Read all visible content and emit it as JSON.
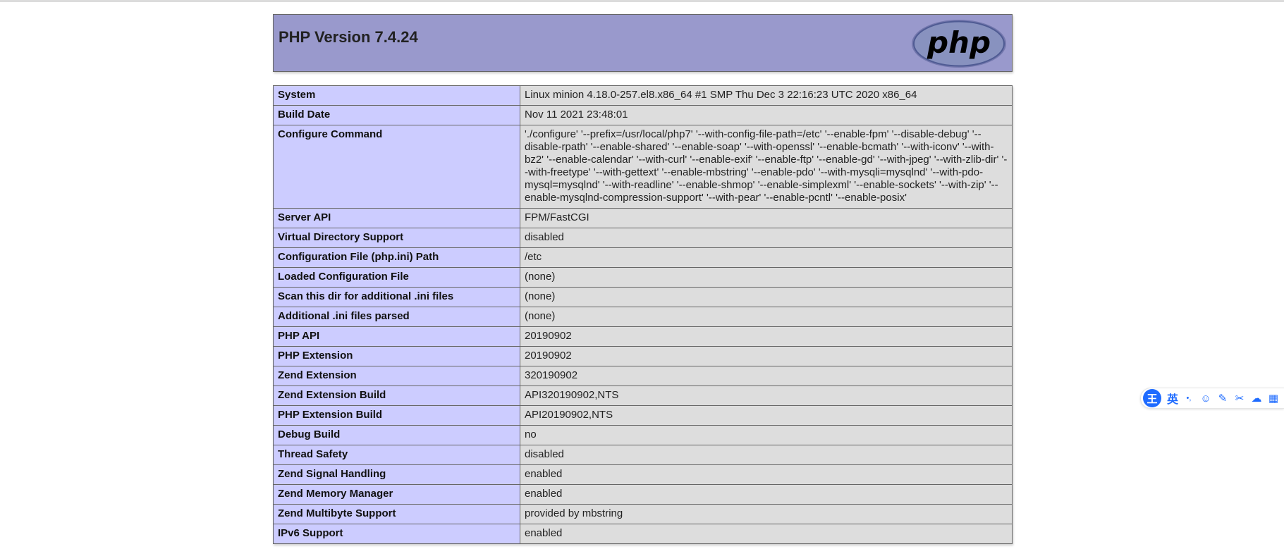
{
  "page": {
    "title": "PHP Version 7.4.24",
    "logo_text": "php"
  },
  "info_rows": [
    {
      "key": "System",
      "value": "Linux minion 4.18.0-257.el8.x86_64 #1 SMP Thu Dec 3 22:16:23 UTC 2020 x86_64"
    },
    {
      "key": "Build Date",
      "value": "Nov 11 2021 23:48:01"
    },
    {
      "key": "Configure Command",
      "value": "'./configure' '--prefix=/usr/local/php7' '--with-config-file-path=/etc' '--enable-fpm' '--disable-debug' '--disable-rpath' '--enable-shared' '--enable-soap' '--with-openssl' '--enable-bcmath' '--with-iconv' '--with-bz2' '--enable-calendar' '--with-curl' '--enable-exif' '--enable-ftp' '--enable-gd' '--with-jpeg' '--with-zlib-dir' '--with-freetype' '--with-gettext' '--enable-mbstring' '--enable-pdo' '--with-mysqli=mysqlnd' '--with-pdo-mysql=mysqlnd' '--with-readline' '--enable-shmop' '--enable-simplexml' '--enable-sockets' '--with-zip' '--enable-mysqlnd-compression-support' '--with-pear' '--enable-pcntl' '--enable-posix'"
    },
    {
      "key": "Server API",
      "value": "FPM/FastCGI"
    },
    {
      "key": "Virtual Directory Support",
      "value": "disabled"
    },
    {
      "key": "Configuration File (php.ini) Path",
      "value": "/etc"
    },
    {
      "key": "Loaded Configuration File",
      "value": "(none)"
    },
    {
      "key": "Scan this dir for additional .ini files",
      "value": "(none)"
    },
    {
      "key": "Additional .ini files parsed",
      "value": "(none)"
    },
    {
      "key": "PHP API",
      "value": "20190902"
    },
    {
      "key": "PHP Extension",
      "value": "20190902"
    },
    {
      "key": "Zend Extension",
      "value": "320190902"
    },
    {
      "key": "Zend Extension Build",
      "value": "API320190902,NTS"
    },
    {
      "key": "PHP Extension Build",
      "value": "API20190902,NTS"
    },
    {
      "key": "Debug Build",
      "value": "no"
    },
    {
      "key": "Thread Safety",
      "value": "disabled"
    },
    {
      "key": "Zend Signal Handling",
      "value": "enabled"
    },
    {
      "key": "Zend Memory Manager",
      "value": "enabled"
    },
    {
      "key": "Zend Multibyte Support",
      "value": "provided by mbstring"
    },
    {
      "key": "IPv6 Support",
      "value": "enabled"
    }
  ],
  "ime_toolbar": {
    "logo_text": "王",
    "language_label": "英",
    "icons": [
      "punctuation-icon",
      "emoji-icon",
      "pen-icon",
      "scissors-icon",
      "cloud-icon",
      "keyboard-icon"
    ]
  }
}
